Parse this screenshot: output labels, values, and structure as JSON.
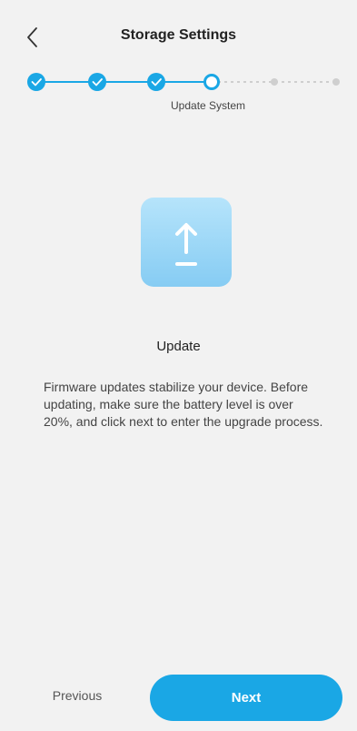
{
  "header": {
    "title": "Storage Settings",
    "back_icon": "chevron-left-icon"
  },
  "stepper": {
    "steps": [
      {
        "state": "done"
      },
      {
        "state": "done"
      },
      {
        "state": "done"
      },
      {
        "state": "current",
        "label": "Update System"
      },
      {
        "state": "pending"
      },
      {
        "state": "pending"
      }
    ],
    "current_label": "Update System"
  },
  "content": {
    "icon": "upload-arrow-icon",
    "title": "Update",
    "description": "Firmware updates stabilize your device. Before updating, make sure the battery level is over 20%, and click next to enter the upgrade process."
  },
  "footer": {
    "previous_label": "Previous",
    "next_label": "Next"
  },
  "colors": {
    "accent": "#1aa7e5",
    "pending": "#cfcfcf",
    "background": "#f2f2f2"
  }
}
